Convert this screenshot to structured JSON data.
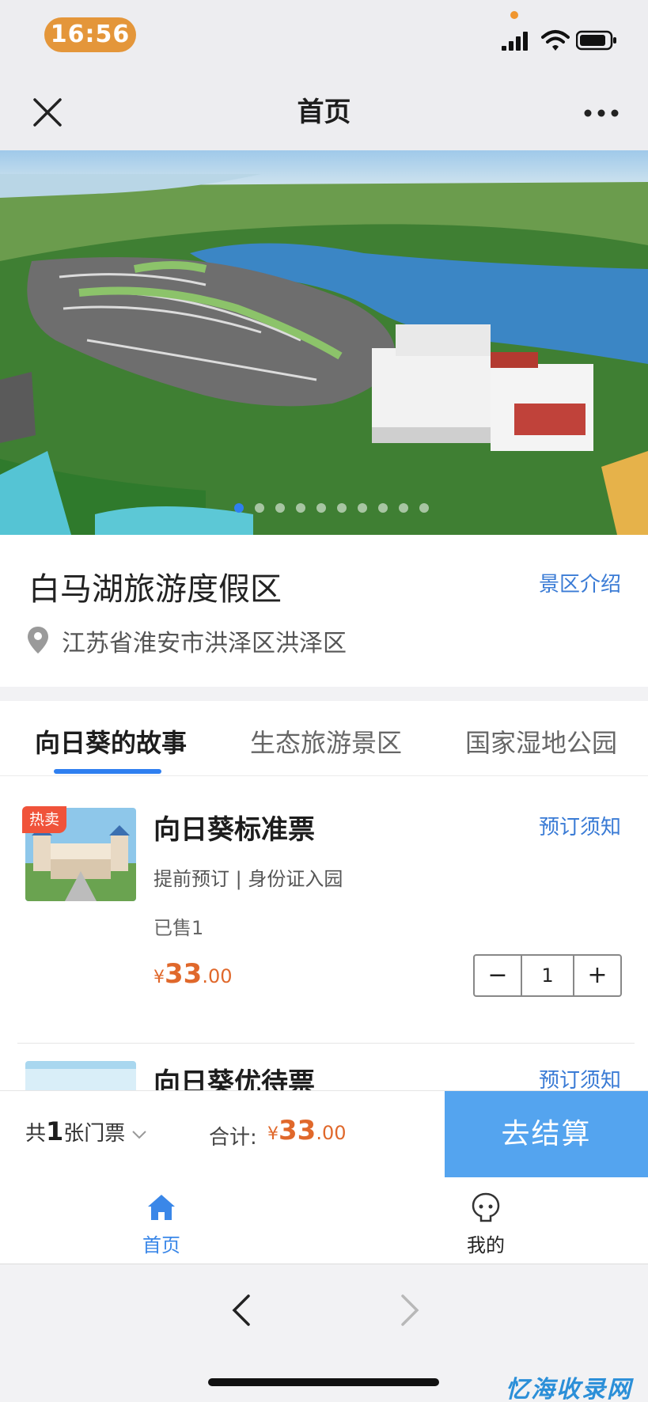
{
  "status_bar": {
    "time": "16:56"
  },
  "nav": {
    "title": "首页"
  },
  "hero": {
    "slide_count": 10,
    "active_index": 0
  },
  "scenic": {
    "name": "白马湖旅游度假区",
    "intro_link": "景区介绍",
    "address": "江苏省淮安市洪泽区洪泽区"
  },
  "tabs": [
    {
      "label": "向日葵的故事",
      "active": true
    },
    {
      "label": "生态旅游景区",
      "active": false
    },
    {
      "label": "国家湿地公园",
      "active": false
    }
  ],
  "tickets": [
    {
      "badge": "热卖",
      "title": "向日葵标准票",
      "notice_link": "预订须知",
      "tags": "提前预订 | 身份证入园",
      "sold": "已售1",
      "price_symbol": "¥",
      "price_int": "33",
      "price_dec": ".00",
      "stepper": {
        "minus": "−",
        "value": "1",
        "plus": "+"
      }
    },
    {
      "title": "向日葵优待票",
      "notice_link": "预订须知"
    }
  ],
  "checkout": {
    "count_prefix": "共",
    "count": "1",
    "count_suffix": "张门票",
    "total_label": "合计:",
    "price_symbol": "¥",
    "price_int": "33",
    "price_dec": ".00",
    "button": "去结算"
  },
  "tabbar": [
    {
      "label": "首页",
      "icon": "home-icon",
      "active": true
    },
    {
      "label": "我的",
      "icon": "profile-icon",
      "active": false
    }
  ],
  "colors": {
    "accent": "#2f7ff0",
    "price": "#e0682b",
    "checkout_button": "#54a4ef",
    "link": "#3a7bd5",
    "hot_badge": "#f0533a"
  },
  "watermark": "忆海收录网"
}
